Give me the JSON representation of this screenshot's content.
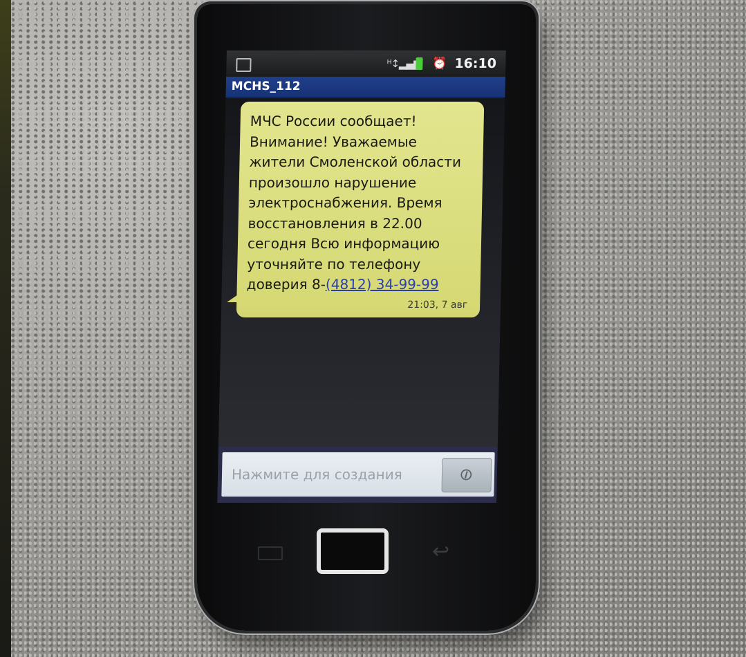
{
  "status_bar": {
    "time": "16:10",
    "icons": [
      "image-icon",
      "signal-icon",
      "battery-icon",
      "alarm-icon"
    ]
  },
  "conversation": {
    "sender": "MCHS_112"
  },
  "message": {
    "lines": [
      "МЧС России сообщает!",
      "Внимание! Уважаемые",
      "жители Смоленской области",
      "произошло нарушение",
      "электроснабжения. Время",
      "восстановления в 22.00",
      "сегодня Всю информацию",
      "уточняйте по телефону"
    ],
    "last_line_prefix": "доверия 8-",
    "phone_link": "(4812) 34-99-99",
    "timestamp": "21:03, 7 авг"
  },
  "compose": {
    "placeholder": "Нажмите для создания",
    "attach_icon": "paperclip-icon"
  },
  "hardware": {
    "keys": [
      "menu-key",
      "home-button",
      "back-key"
    ]
  }
}
